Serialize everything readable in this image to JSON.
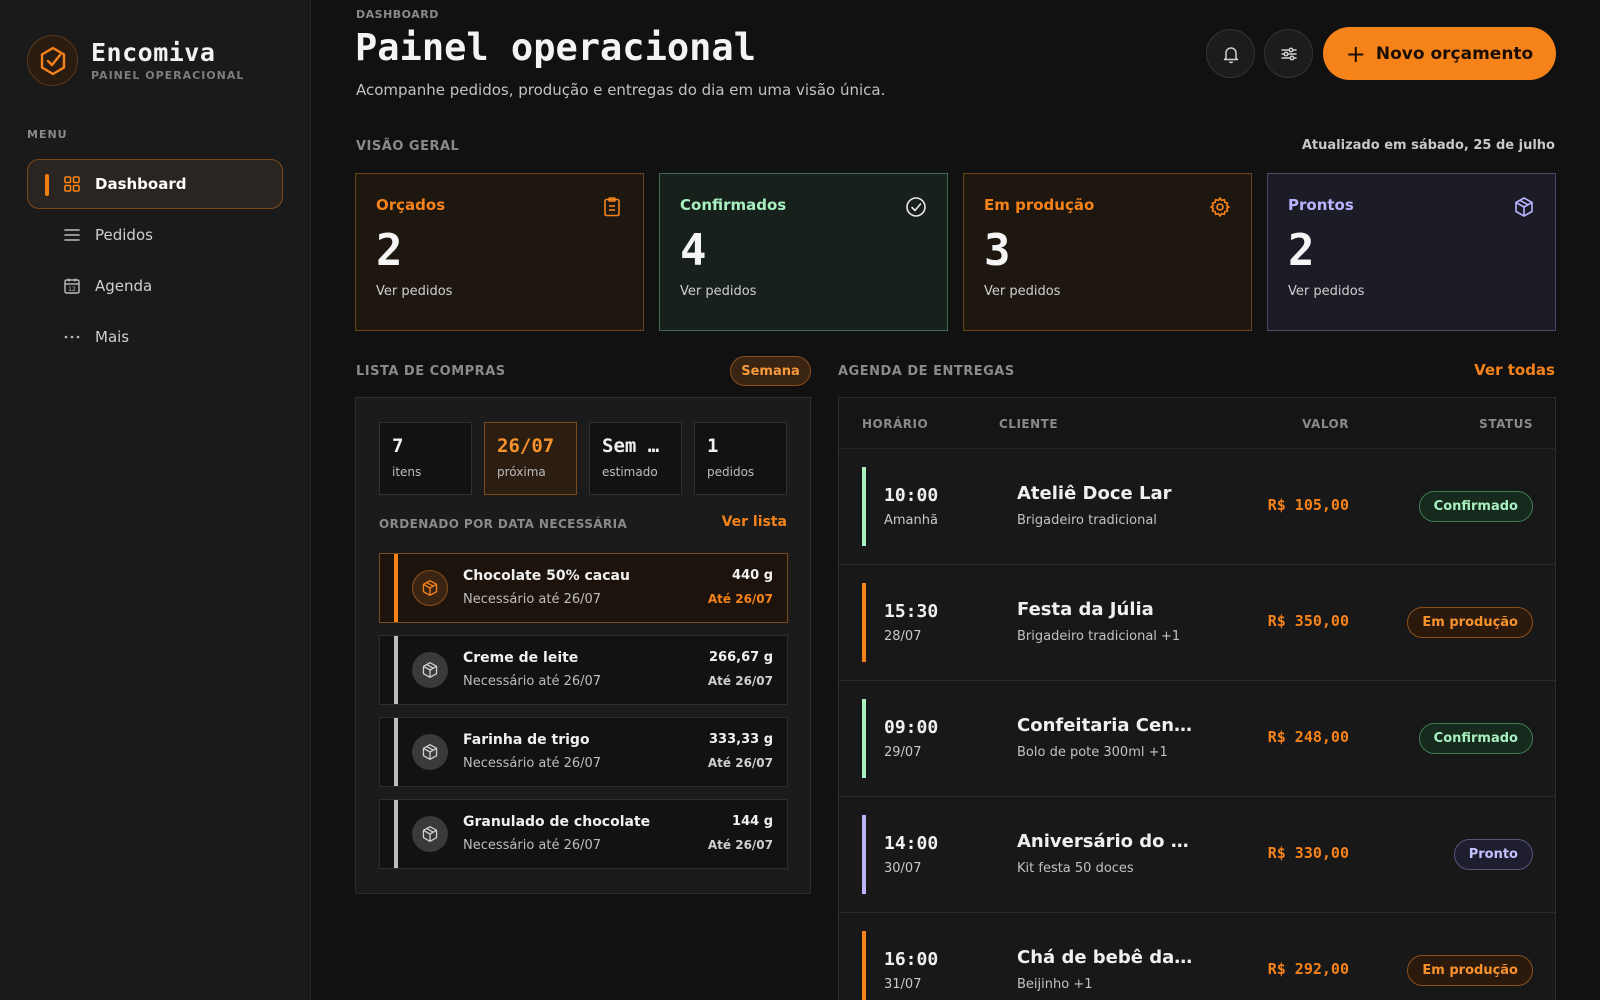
{
  "brand": {
    "name": "Encomiva",
    "subtitle": "PAINEL OPERACIONAL"
  },
  "sidebar": {
    "menu_label": "MENU",
    "items": [
      {
        "label": "Dashboard",
        "icon": "grid-icon",
        "active": true
      },
      {
        "label": "Pedidos",
        "icon": "list-icon",
        "active": false
      },
      {
        "label": "Agenda",
        "icon": "calendar-icon",
        "active": false
      },
      {
        "label": "Mais",
        "icon": "more-icon",
        "active": false
      }
    ]
  },
  "header": {
    "breadcrumb": "DASHBOARD",
    "title": "Painel operacional",
    "subtitle": "Acompanhe pedidos, produção e entregas do dia em uma visão única.",
    "new_button": "Novo orçamento"
  },
  "overview": {
    "label": "VISÃO GERAL",
    "updated": "Atualizado em sábado, 25 de julho",
    "cards": [
      {
        "title": "Orçados",
        "count": "2",
        "link": "Ver pedidos",
        "icon": "clipboard-icon",
        "color": "#f6831a"
      },
      {
        "title": "Confirmados",
        "count": "4",
        "link": "Ver pedidos",
        "icon": "check-circle-icon",
        "color": "#a8f0c0"
      },
      {
        "title": "Em produção",
        "count": "3",
        "link": "Ver pedidos",
        "icon": "gear-icon",
        "color": "#f6831a"
      },
      {
        "title": "Prontos",
        "count": "2",
        "link": "Ver pedidos",
        "icon": "box-icon",
        "color": "#b8b4ff"
      }
    ]
  },
  "shopping": {
    "label": "LISTA DE COMPRAS",
    "chip": "Semana",
    "stats": [
      {
        "value": "7",
        "label": "itens"
      },
      {
        "value": "26/07",
        "label": "próxima"
      },
      {
        "value": "Sem …",
        "label": "estimado"
      },
      {
        "value": "1",
        "label": "pedidos"
      }
    ],
    "order_label": "ORDENADO POR DATA NECESSÁRIA",
    "see_list": "Ver lista",
    "items": [
      {
        "name": "Chocolate 50% cacau",
        "need": "Necessário até 26/07",
        "qty": "440 g",
        "until": "Até 26/07"
      },
      {
        "name": "Creme de leite",
        "need": "Necessário até 26/07",
        "qty": "266,67 g",
        "until": "Até 26/07"
      },
      {
        "name": "Farinha de trigo",
        "need": "Necessário até 26/07",
        "qty": "333,33 g",
        "until": "Até 26/07"
      },
      {
        "name": "Granulado de chocolate",
        "need": "Necessário até 26/07",
        "qty": "144 g",
        "until": "Até 26/07"
      }
    ]
  },
  "deliveries": {
    "label": "AGENDA DE ENTREGAS",
    "see_all": "Ver todas",
    "columns": {
      "time": "HORÁRIO",
      "client": "CLIENTE",
      "value": "VALOR",
      "status": "STATUS"
    },
    "rows": [
      {
        "time": "10:00",
        "date": "Amanhã",
        "client": "Ateliê Doce Lar",
        "product": "Brigadeiro tradicional",
        "value": "R$ 105,00",
        "status": "Confirmado",
        "status_kind": "conf",
        "bar_color": "#a8f0c0"
      },
      {
        "time": "15:30",
        "date": "28/07",
        "client": "Festa da Júlia",
        "product": "Brigadeiro tradicional +1",
        "value": "R$ 350,00",
        "status": "Em produção",
        "status_kind": "prod",
        "bar_color": "#f6831a"
      },
      {
        "time": "09:00",
        "date": "29/07",
        "client": "Confeitaria Central",
        "product": "Bolo de pote 300ml +1",
        "value": "R$ 248,00",
        "status": "Confirmado",
        "status_kind": "conf",
        "bar_color": "#a8f0c0"
      },
      {
        "time": "14:00",
        "date": "30/07",
        "client": "Aniversário do Pe…",
        "product": "Kit festa 50 doces",
        "value": "R$ 330,00",
        "status": "Pronto",
        "status_kind": "ready",
        "bar_color": "#b8b4ff"
      },
      {
        "time": "16:00",
        "date": "31/07",
        "client": "Chá de bebê da Lu…",
        "product": "Beijinho +1",
        "value": "R$ 292,00",
        "status": "Em produção",
        "status_kind": "prod",
        "bar_color": "#f6831a"
      }
    ]
  }
}
